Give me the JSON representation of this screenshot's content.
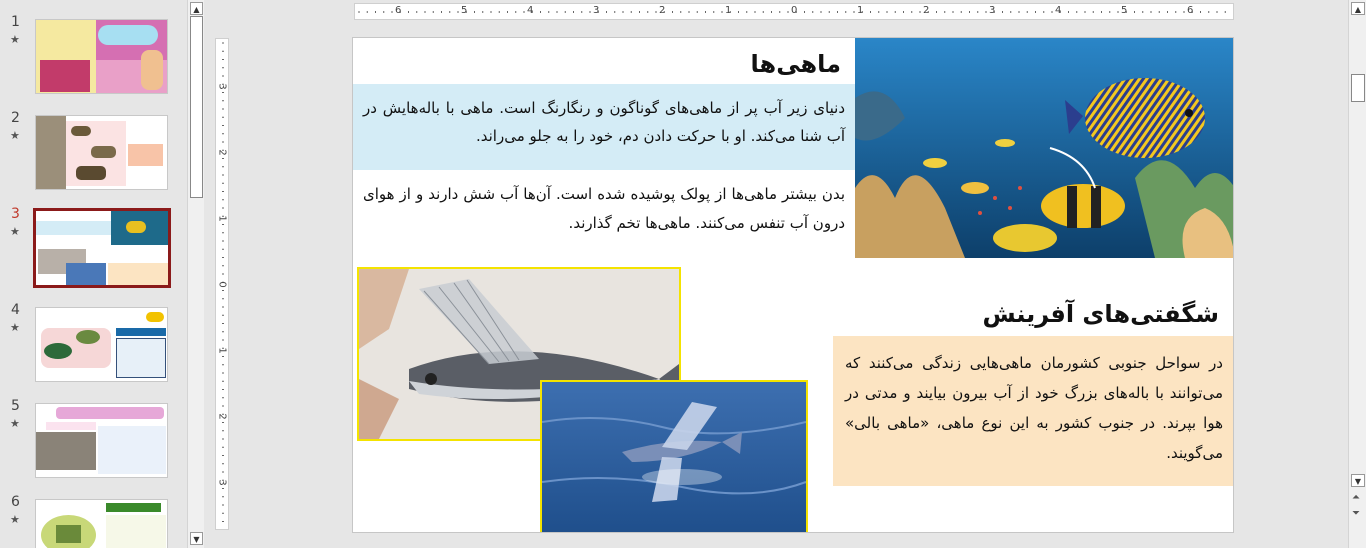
{
  "thumbnails": [
    {
      "number": "1",
      "star": "★"
    },
    {
      "number": "2",
      "star": "★"
    },
    {
      "number": "3",
      "star": "★",
      "active": true
    },
    {
      "number": "4",
      "star": "★"
    },
    {
      "number": "5",
      "star": "★"
    },
    {
      "number": "6",
      "star": "★"
    }
  ],
  "ruler": {
    "h_labels": [
      "6",
      "5",
      "4",
      "3",
      "2",
      "1",
      "0",
      "1",
      "2",
      "3",
      "4",
      "5",
      "6"
    ],
    "v_labels": [
      "3",
      "2",
      "1",
      "0",
      "1",
      "2",
      "3"
    ]
  },
  "slide": {
    "title_fish": "ماهی‌ها",
    "box1_text": "دنیای زیر آب پر از ماهی‌های گوناگون و رنگارنگ است. ماهی با باله‌هایش در آب شنا می‌کند. او با حرکت دادن دم، خود را به جلو می‌راند.",
    "para2_text": "بدن بیشتر ماهی‌ها از پولک پوشیده شده است. آن‌ها آب شش دارند و از هوای درون آب تنفس می‌کنند. ماهی‌ها تخم گذارند.",
    "title_wonders": "شگفتی‌های آفرینش",
    "box2_text": "در سواحل جنوبی کشورمان ماهی‌هایی زندگی می‌کنند که می‌توانند با باله‌های بزرگ خود از آب بیرون بیایند و مدتی در هوا بپرند. در جنوب کشور به این نوع ماهی، «ماهی بالی» می‌گویند."
  },
  "colors": {
    "box1_bg": "#d4ecf6",
    "box2_bg": "#fce4c2",
    "photo_border": "#f4e300",
    "active_thumb_border": "#8b1a1a"
  }
}
